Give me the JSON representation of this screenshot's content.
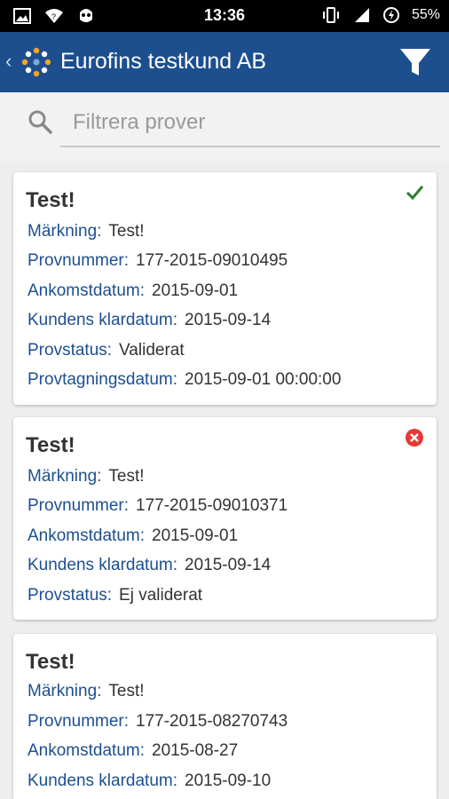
{
  "statusbar": {
    "time": "13:36",
    "battery": "55%"
  },
  "appbar": {
    "title": "Eurofins testkund AB"
  },
  "search": {
    "placeholder": "Filtrera prover"
  },
  "cards": [
    {
      "title": "Test!",
      "status_icon": "check-icon",
      "fields": [
        {
          "label": "Märkning:",
          "value": "Test!"
        },
        {
          "label": "Provnummer:",
          "value": "177-2015-09010495"
        },
        {
          "label": "Ankomstdatum:",
          "value": "2015-09-01"
        },
        {
          "label": "Kundens klardatum:",
          "value": "2015-09-14"
        },
        {
          "label": "Provstatus:",
          "value": "Validerat"
        },
        {
          "label": "Provtagningsdatum:",
          "value": "2015-09-01 00:00:00"
        }
      ]
    },
    {
      "title": "Test!",
      "status_icon": "error-icon",
      "fields": [
        {
          "label": "Märkning:",
          "value": "Test!"
        },
        {
          "label": "Provnummer:",
          "value": "177-2015-09010371"
        },
        {
          "label": "Ankomstdatum:",
          "value": "2015-09-01"
        },
        {
          "label": "Kundens klardatum:",
          "value": "2015-09-14"
        },
        {
          "label": "Provstatus:",
          "value": "Ej validerat"
        }
      ]
    },
    {
      "title": "Test!",
      "status_icon": "",
      "fields": [
        {
          "label": "Märkning:",
          "value": "Test!"
        },
        {
          "label": "Provnummer:",
          "value": "177-2015-08270743"
        },
        {
          "label": "Ankomstdatum:",
          "value": "2015-08-27"
        },
        {
          "label": "Kundens klardatum:",
          "value": "2015-09-10"
        }
      ]
    }
  ],
  "colors": {
    "appbar": "#1d4f8f",
    "label": "#1d4f8f",
    "check": "#2e7d32",
    "error": "#e53935"
  }
}
